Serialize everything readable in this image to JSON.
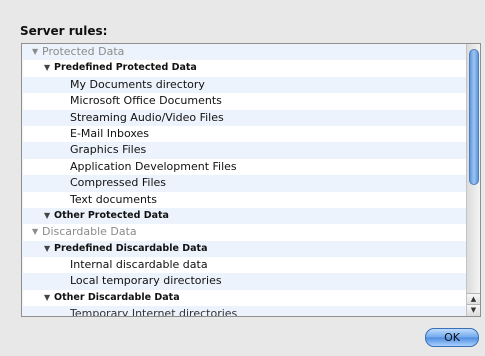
{
  "dialog": {
    "title": "Server rules:",
    "ok_label": "OK"
  },
  "tree": {
    "rows": [
      {
        "label": "Protected Data",
        "level": 0,
        "type": "group",
        "expanded": true,
        "dimmed": true
      },
      {
        "label": "Predefined Protected Data",
        "level": 1,
        "type": "section",
        "expanded": true
      },
      {
        "label": "My Documents directory",
        "level": 2,
        "type": "item"
      },
      {
        "label": "Microsoft Office Documents",
        "level": 2,
        "type": "item"
      },
      {
        "label": "Streaming Audio/Video  Files",
        "level": 2,
        "type": "item"
      },
      {
        "label": "E-Mail Inboxes",
        "level": 2,
        "type": "item"
      },
      {
        "label": "Graphics Files",
        "level": 2,
        "type": "item"
      },
      {
        "label": "Application Development Files",
        "level": 2,
        "type": "item"
      },
      {
        "label": "Compressed Files",
        "level": 2,
        "type": "item"
      },
      {
        "label": "Text documents",
        "level": 2,
        "type": "item"
      },
      {
        "label": "Other Protected Data",
        "level": 1,
        "type": "section",
        "expanded": true
      },
      {
        "label": "Discardable Data",
        "level": 0,
        "type": "group",
        "expanded": true,
        "dimmed": true
      },
      {
        "label": "Predefined Discardable Data",
        "level": 1,
        "type": "section",
        "expanded": true
      },
      {
        "label": "Internal discardable data",
        "level": 2,
        "type": "item"
      },
      {
        "label": "Local temporary directories",
        "level": 2,
        "type": "item"
      },
      {
        "label": "Other Discardable Data",
        "level": 1,
        "type": "section",
        "expanded": true
      },
      {
        "label": "Temporary Internet directories",
        "level": 2,
        "type": "item",
        "clipped": true
      }
    ]
  },
  "icons": {
    "expanded": "disclosure-triangle-down-icon",
    "scroll_up": "scroll-up-arrow-icon",
    "scroll_down": "scroll-down-arrow-icon"
  },
  "colors": {
    "accent": "#5f97dd",
    "alt_row": "#edf3fc",
    "dimmed_text": "#8b8b8b"
  }
}
